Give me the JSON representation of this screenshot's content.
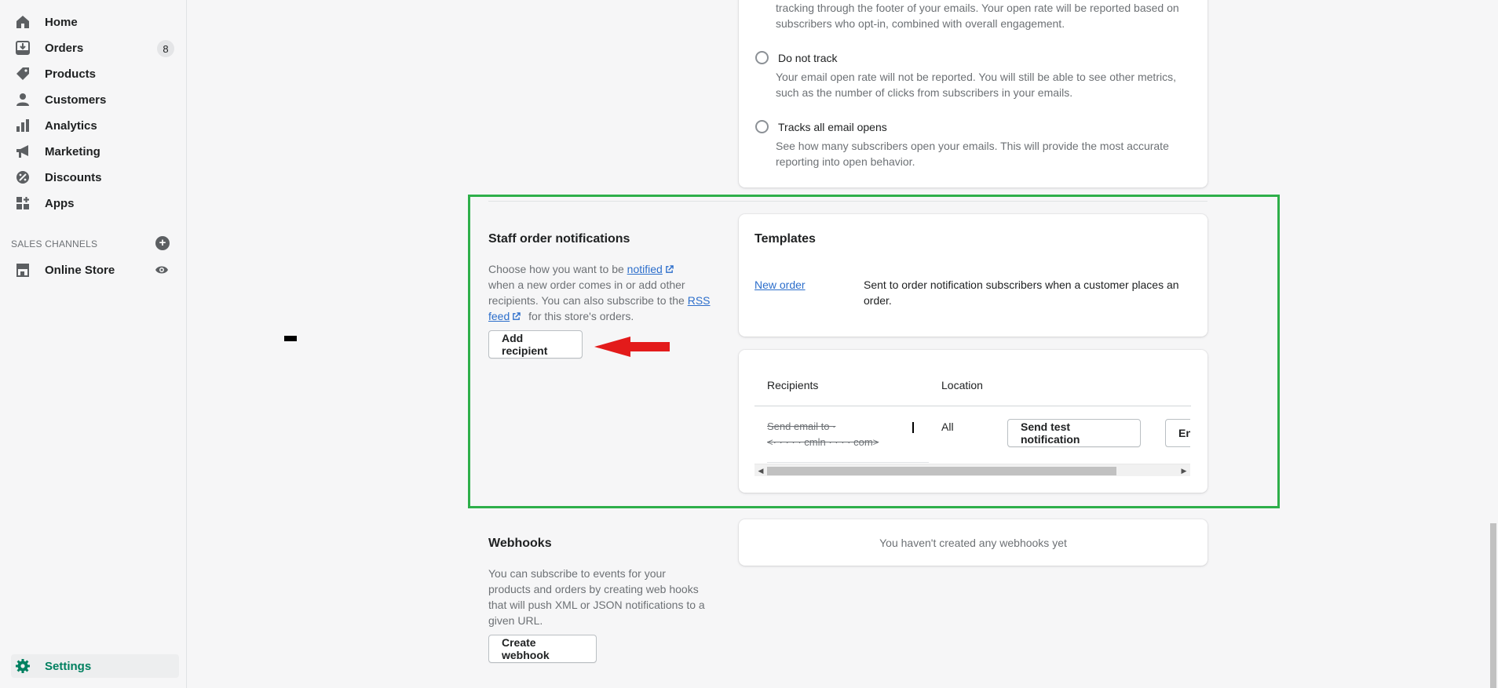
{
  "sidebar": {
    "items": [
      {
        "label": "Home",
        "icon": "home-icon"
      },
      {
        "label": "Orders",
        "icon": "orders-icon",
        "badge": "8"
      },
      {
        "label": "Products",
        "icon": "tag-icon"
      },
      {
        "label": "Customers",
        "icon": "person-icon"
      },
      {
        "label": "Analytics",
        "icon": "bar-chart-icon"
      },
      {
        "label": "Marketing",
        "icon": "megaphone-icon"
      },
      {
        "label": "Discounts",
        "icon": "discount-icon"
      },
      {
        "label": "Apps",
        "icon": "apps-icon"
      }
    ],
    "sales_channels_title": "SALES CHANNELS",
    "online_store": "Online Store",
    "settings": "Settings"
  },
  "tracking": {
    "top_text_line1": "tracking through the footer of your emails. Your open rate will be reported based on",
    "top_text_line2": "subscribers who opt-in, combined with overall engagement.",
    "options": [
      {
        "label": "Do not track",
        "desc_line1": "Your email open rate will not be reported. You will still be able to see other metrics,",
        "desc_line2": "such as the number of clicks from subscribers in your emails."
      },
      {
        "label": "Tracks all email opens",
        "desc_line1": "See how many subscribers open your emails. This will provide the most accurate",
        "desc_line2": "reporting into open behavior."
      }
    ]
  },
  "staff": {
    "title": "Staff order notifications",
    "desc_1": "Choose how you want to be",
    "notified_link": "notified",
    "desc_2": "when a new order comes in or add other",
    "desc_3": "recipients. You can also subscribe to the",
    "rss_link_1": "RSS",
    "rss_link_2": "feed",
    "desc_4": "for this store's orders.",
    "add_recipient": "Add recipient"
  },
  "templates": {
    "title": "Templates",
    "new_order": "New order",
    "new_order_desc": "Sent to order notification subscribers when a customer places an order."
  },
  "recipients": {
    "col_recipients": "Recipients",
    "col_location": "Location",
    "row_line1": "Send email to ·",
    "row_line2": "<· · · · · cmln · · · · com>",
    "row_location": "All",
    "send_test": "Send test notification",
    "enable_partial": "En"
  },
  "webhooks": {
    "title": "Webhooks",
    "desc_1": "You can subscribe to events for your",
    "desc_2": "products and orders by creating web hooks",
    "desc_3": "that will push XML or JSON notifications to a",
    "desc_4": "given URL.",
    "create": "Create webhook",
    "empty": "You haven't created any webhooks yet"
  },
  "colors": {
    "highlight_border": "#2eaf4a",
    "arrow": "#e31b1b",
    "link": "#2c6ecb",
    "active": "#008060"
  }
}
